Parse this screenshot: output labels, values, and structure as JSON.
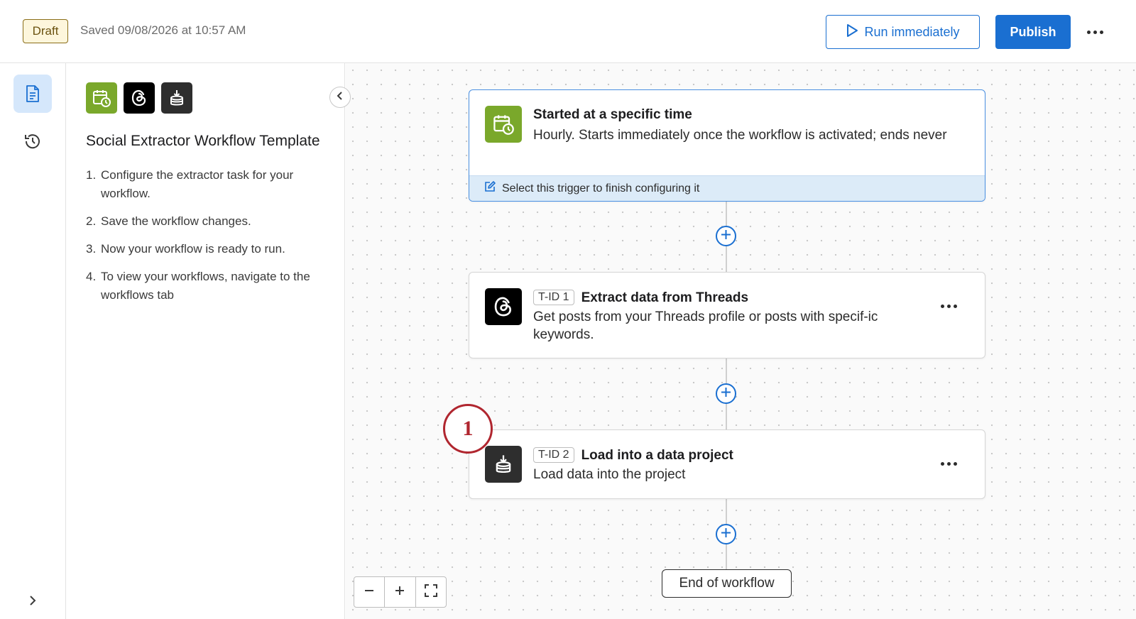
{
  "header": {
    "status_badge": "Draft",
    "saved_text": "Saved 09/08/2026 at 10:57 AM",
    "run_label": "Run immediately",
    "publish_label": "Publish"
  },
  "panel": {
    "title": "Social Extractor Workflow Template",
    "app_icons": [
      "calendar-clock-icon",
      "threads-icon",
      "data-load-icon"
    ],
    "steps": [
      {
        "num": "1.",
        "text": "Configure the extractor task for your workflow."
      },
      {
        "num": "2.",
        "text": "Save the workflow changes."
      },
      {
        "num": "3.",
        "text": "Now your workflow is ready to run."
      },
      {
        "num": "4.",
        "text": "To view your workflows, navigate to the workflows tab"
      }
    ]
  },
  "trigger": {
    "title": "Started at a specific time",
    "description": "Hourly. Starts immediately once the workflow is activated; ends never",
    "footer": "Select this trigger to finish configuring it",
    "icon": "calendar-clock-icon"
  },
  "tasks": [
    {
      "tid": "T-ID 1",
      "title": "Extract data from Threads",
      "description": "Get posts from your Threads profile or posts with specif-ic keywords.",
      "icon": "threads-icon"
    },
    {
      "tid": "T-ID 2",
      "title": "Load into a data project",
      "description": "Load data into the project",
      "icon": "data-load-icon"
    }
  ],
  "end_label": "End of workflow",
  "callout_number": "1",
  "colors": {
    "accent": "#1a6fd1",
    "trigger_green": "#7aa82b",
    "callout_red": "#b0262f",
    "draft_badge": "#fdf6dc"
  }
}
